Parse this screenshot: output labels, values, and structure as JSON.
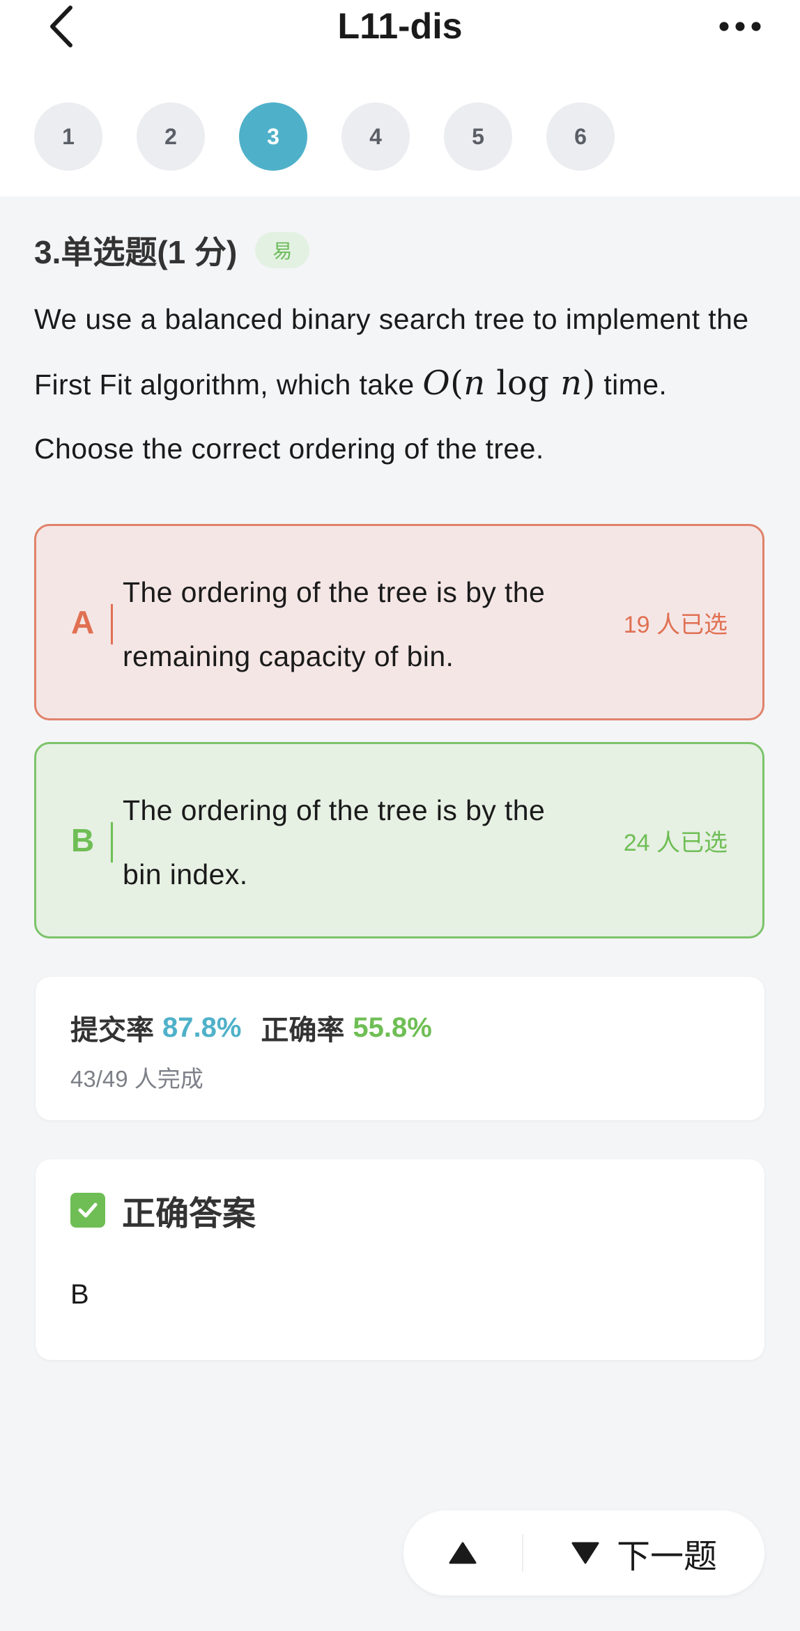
{
  "header": {
    "title": "L11-dis"
  },
  "question_nav": [
    "1",
    "2",
    "3",
    "4",
    "5",
    "6"
  ],
  "active_question": "3",
  "question": {
    "type_label": "3.单选题(1 分)",
    "difficulty": "易",
    "text_part1": "We use a balanced binary search tree to implement the First Fit algorithm, which take ",
    "math_O": "O",
    "math_open": "(",
    "math_n1": "n",
    "math_log": "log",
    "math_n2": "n",
    "math_close": ")",
    "text_part2": " time. Choose the correct ordering of the tree."
  },
  "options": [
    {
      "letter": "A",
      "text": "The ordering of the tree is by the remaining capacity of bin.",
      "count": "19 人已选",
      "state": "wrong"
    },
    {
      "letter": "B",
      "text": "The ordering of the tree is by the bin index.",
      "count": "24 人已选",
      "state": "correct"
    }
  ],
  "stats": {
    "submit_label": "提交率",
    "submit_rate": "87.8%",
    "correct_label": "正确率",
    "correct_rate": "55.8%",
    "completion": "43/49 人完成"
  },
  "answer": {
    "title": "正确答案",
    "value": "B"
  },
  "bottom_nav": {
    "next_label": "下一题"
  },
  "colors": {
    "accent": "#4fb1c9",
    "correct": "#6fbe55",
    "wrong": "#e07052"
  },
  "icons": {
    "back": "chevron-left-icon",
    "more": "more-horizontal-icon",
    "check": "checkbox-checked-icon",
    "prev": "triangle-up-icon",
    "next": "triangle-down-icon"
  }
}
